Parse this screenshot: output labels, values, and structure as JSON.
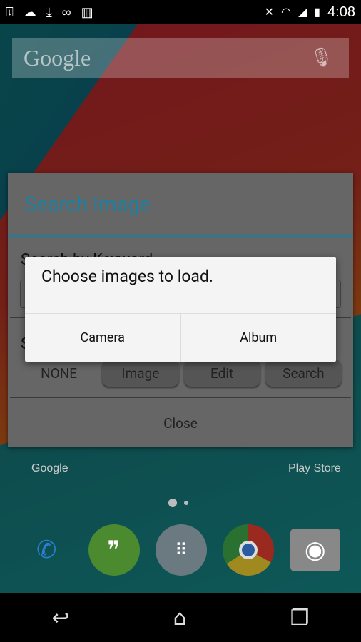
{
  "status_bar": {
    "left_icons": [
      "download-icon",
      "cloud-upload-icon",
      "download-icon",
      "voicemail-icon",
      "barcode-icon"
    ],
    "right_icons": [
      "vibrate-off-icon",
      "wifi-icon",
      "signal-icon",
      "battery-charging-icon"
    ],
    "time": "4:08"
  },
  "home": {
    "search_brand": "Google",
    "app_labels": [
      "Google",
      "Play Store"
    ],
    "dock": [
      "phone-icon",
      "hangouts-icon",
      "app-drawer-icon",
      "chrome-icon",
      "camera-icon"
    ]
  },
  "search_dialog": {
    "title": "Search Image",
    "keyword_label": "Search by Keyword",
    "second_label": "S",
    "mode_value": "NONE",
    "buttons": [
      "Image",
      "Edit",
      "Search"
    ],
    "close": "Close",
    "accent": "#1f7e9e"
  },
  "alert": {
    "message": "Choose images to load.",
    "buttons": [
      "Camera",
      "Album"
    ]
  }
}
